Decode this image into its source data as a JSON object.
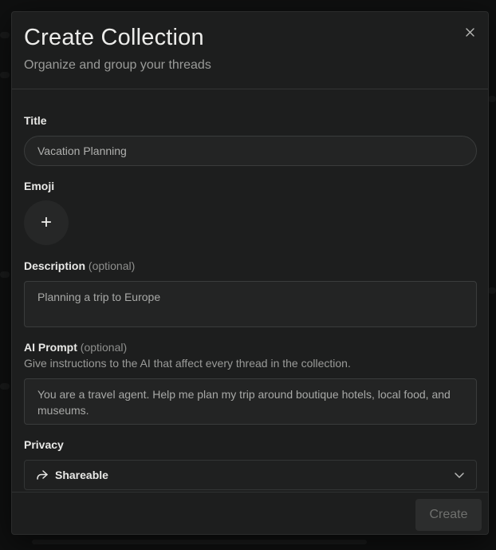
{
  "modal": {
    "title": "Create Collection",
    "subtitle": "Organize and group your threads",
    "close_icon": "close-icon"
  },
  "fields": {
    "title": {
      "label": "Title",
      "value": "Vacation Planning"
    },
    "emoji": {
      "label": "Emoji",
      "add_glyph": "+"
    },
    "description": {
      "label": "Description",
      "optional": "(optional)",
      "value": "Planning a trip to Europe"
    },
    "ai_prompt": {
      "label": "AI Prompt",
      "optional": "(optional)",
      "helper": "Give instructions to the AI that affect every thread in the collection.",
      "value": "You are a travel agent. Help me plan my trip around boutique hotels, local food, and museums."
    },
    "privacy": {
      "label": "Privacy",
      "selected": "Shareable",
      "icon": "share-icon"
    }
  },
  "footer": {
    "create_label": "Create"
  },
  "colors": {
    "modal_bg": "#1d1e1e",
    "backdrop": "#0f1010",
    "input_bg": "#232424",
    "border": "#3a3c3c",
    "text": "#e8e8e6",
    "muted": "#9a9b99",
    "disabled_btn": "#2c2d2d"
  }
}
